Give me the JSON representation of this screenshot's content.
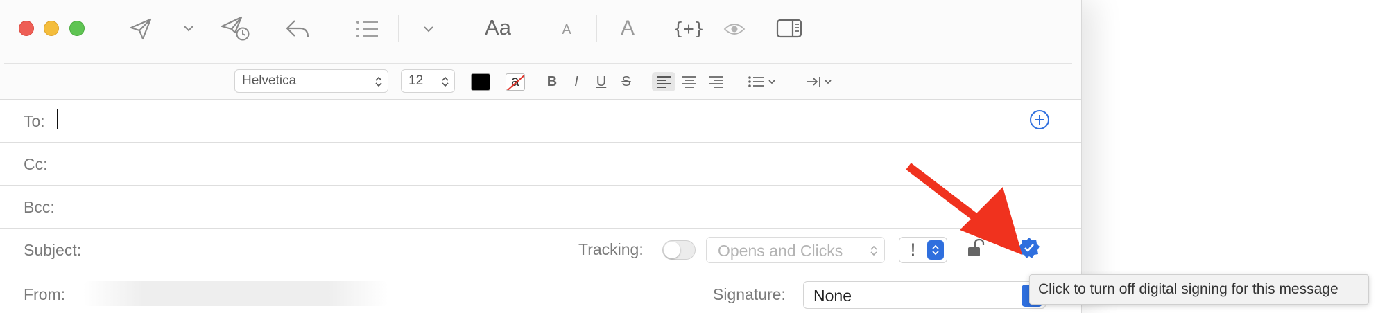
{
  "toolbar": {
    "icons": [
      "paper-plane-icon",
      "chevron-down-icon",
      "send-later-icon",
      "reply-icon",
      "bullet-list-icon",
      "chevron-down-icon",
      "font-panel-icon",
      "smaller-font-icon",
      "bigger-font-icon",
      "insert-field-icon",
      "preview-eye-icon",
      "sidebar-icon"
    ],
    "font_panel_label": "Aa",
    "smaller_label": "A",
    "bigger_label": "A",
    "insert_label": "{+}"
  },
  "format": {
    "font_family": "Helvetica",
    "font_size": "12",
    "text_color": "#000000",
    "bold": "B",
    "italic": "I",
    "underline": "U",
    "strike": "S",
    "highlight_glyph": "a"
  },
  "fields": {
    "to_label": "To:",
    "cc_label": "Cc:",
    "bcc_label": "Bcc:",
    "subject_label": "Subject:",
    "from_label": "From:"
  },
  "tracking": {
    "label": "Tracking:",
    "enabled": false,
    "mode": "Opens and Clicks"
  },
  "priority": {
    "symbol": "!"
  },
  "signature": {
    "label": "Signature:",
    "value": "None"
  },
  "tooltip": {
    "text": "Click to turn off digital signing for this message"
  },
  "colors": {
    "accent": "#2f6fde",
    "arrow": "#f0321e",
    "close": "#ee5e55",
    "minimize": "#f4bd3c",
    "zoom": "#5fc453"
  }
}
